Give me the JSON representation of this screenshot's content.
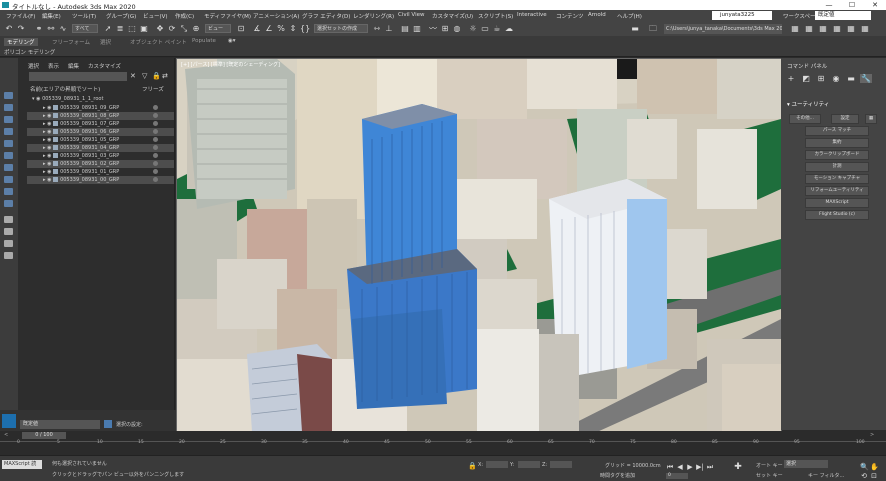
{
  "window": {
    "title": "タイトルなし - Autodesk 3ds Max 2020",
    "minimize": "—",
    "maximize": "☐",
    "close": "✕"
  },
  "menubar": {
    "items": [
      "ファイル(F)",
      "編集(E)",
      "ツール(T)",
      "グループ(G)",
      "ビュー(V)",
      "作成(C)",
      "モディファイヤ(M)",
      "アニメーション(A)",
      "グラフ エディタ(D)",
      "レンダリング(R)",
      "Civil View",
      "カスタマイズ(U)",
      "スクリプト(S)",
      "Interactive",
      "コンテンツ",
      "Arnold",
      "ヘルプ(H)"
    ],
    "user": "junyata3225",
    "workspace_label": "ワークスペース:",
    "workspace_value": "既定値"
  },
  "toolbar": {
    "filter": "すべて",
    "view": "ビュー",
    "selection_set": "選択セットの作成",
    "path": "C:\\Users\\junya_tanaka\\Documents\\3ds Max 2020",
    "icons": [
      "undo-icon",
      "redo-icon",
      "link-icon",
      "unlink-icon",
      "bind-icon",
      "select-icon",
      "select-region-icon",
      "move-icon",
      "rotate-icon",
      "scale-icon",
      "placement-icon",
      "pivot-icon",
      "snap-3d-icon",
      "snap-angle-icon",
      "snap-percent-icon",
      "snap-spinner-icon",
      "mirror-icon",
      "align-icon",
      "layer-icon",
      "curve-editor-icon",
      "schematic-icon",
      "material-editor-icon",
      "render-setup-icon",
      "rendered-frame-icon",
      "render-icon"
    ]
  },
  "ribbon": {
    "tabs": [
      "モデリング",
      "フリーフォーム",
      "選択",
      "オブジェクト ペイント",
      "Populate"
    ],
    "sub": "ポリゴン モデリング"
  },
  "explorer": {
    "menu": [
      "選択",
      "表示",
      "編集",
      "カスタマイズ"
    ],
    "col_name": "名前(エリアの昇順でソート)",
    "col_freeze": "フリーズ",
    "root": "005339_08931_1_1_root",
    "rows": [
      "005339_08931_09_GRP",
      "005339_08931_08_GRP",
      "005339_08931_07_GRP",
      "005339_08931_06_GRP",
      "005339_08931_05_GRP",
      "005339_08931_04_GRP",
      "005339_08931_03_GRP",
      "005339_08931_02_GRP",
      "005339_08931_01_GRP",
      "005339_08931_00_GRP"
    ]
  },
  "viewport": {
    "label": "[+] [パース] [標準] [既定のシェーディング]"
  },
  "cmdpanel": {
    "title": "コマンド パネル",
    "rollout": "ユーティリティ",
    "more": "その他...",
    "sets": "設定",
    "buttons": [
      "パース マッチ",
      "集約",
      "カラークリップボード",
      "計測",
      "モーション キャプチャ",
      "リフォームユーティリティ",
      "MAXScript",
      "Flight Studio (c)"
    ]
  },
  "bottomleft": {
    "layer_value": "既定値",
    "layer_explorer": "選択の設定:"
  },
  "timeline": {
    "frame": "0 / 100",
    "ticks": [
      "0",
      "5",
      "10",
      "15",
      "20",
      "25",
      "30",
      "35",
      "40",
      "45",
      "50",
      "55",
      "60",
      "65",
      "70",
      "75",
      "80",
      "85",
      "90",
      "95",
      "100"
    ]
  },
  "status": {
    "maxscript": "MAXScript 読",
    "line1": "何も選択されていません",
    "line2": "クリックとドラッグでパン ビュー以外をパンニングします",
    "x_label": "X:",
    "y_label": "Y:",
    "z_label": "Z:",
    "grid": "グリッド = 10000.0cm",
    "addtime": "時間タグを追加",
    "autokey": "オート キー",
    "setkey": "セット キー",
    "selected": "選択",
    "keyfilters": "キー フィルタ...",
    "frame_value": "0"
  }
}
